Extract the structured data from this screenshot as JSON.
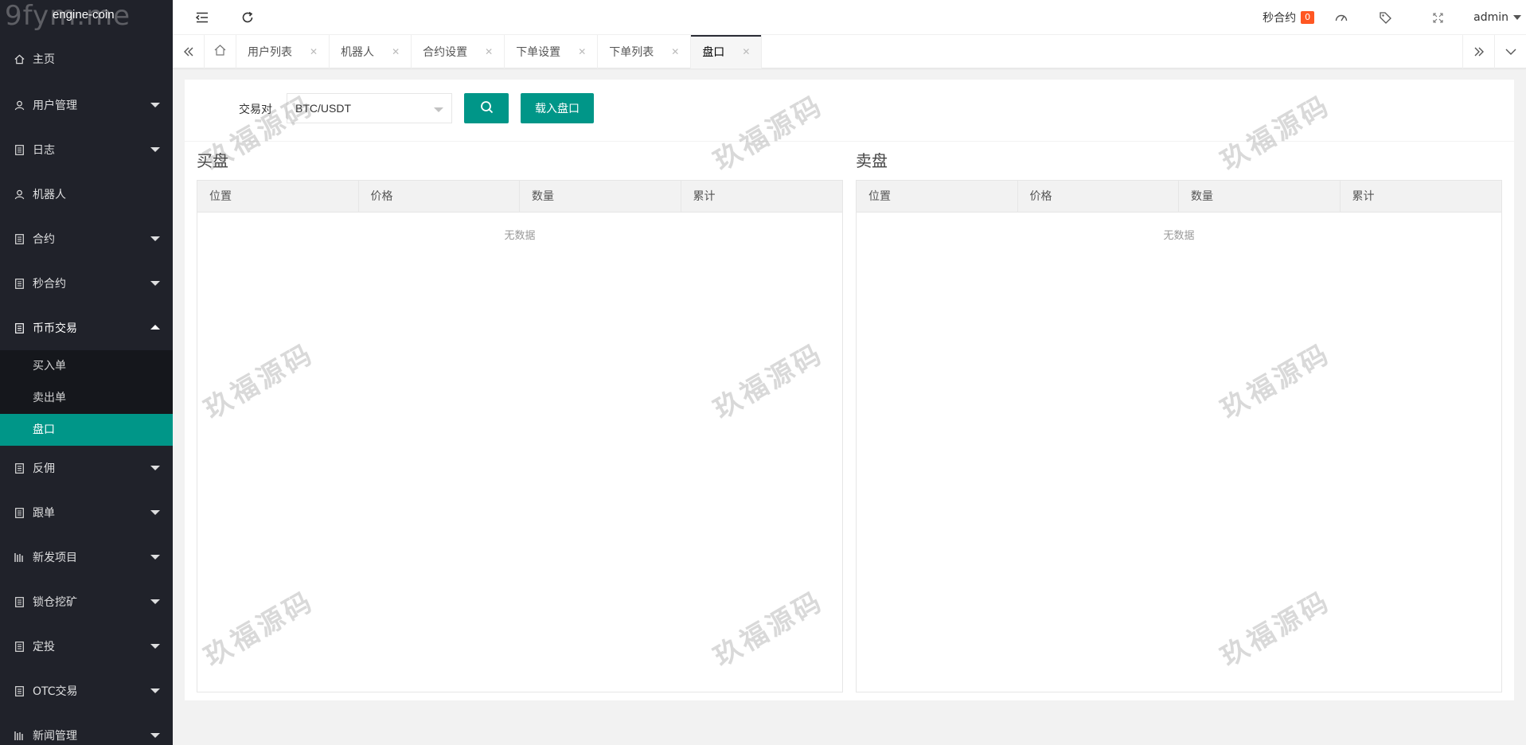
{
  "logo": {
    "watermark": "9fym.me",
    "title": "engine-coin"
  },
  "sidebar": {
    "items": [
      {
        "label": "主页",
        "icon": "home-icon",
        "expandable": false
      },
      {
        "label": "用户管理",
        "icon": "user-icon",
        "expandable": true
      },
      {
        "label": "日志",
        "icon": "document-icon",
        "expandable": true
      },
      {
        "label": "机器人",
        "icon": "user-icon",
        "expandable": false
      },
      {
        "label": "合约",
        "icon": "document-icon",
        "expandable": true
      },
      {
        "label": "秒合约",
        "icon": "document-icon",
        "expandable": true
      },
      {
        "label": "币币交易",
        "icon": "document-icon",
        "expandable": true,
        "open": true,
        "children": [
          {
            "label": "买入单"
          },
          {
            "label": "卖出单"
          },
          {
            "label": "盘口",
            "active": true
          }
        ]
      },
      {
        "label": "反佣",
        "icon": "document-icon",
        "expandable": true
      },
      {
        "label": "跟单",
        "icon": "document-icon",
        "expandable": true
      },
      {
        "label": "新发项目",
        "icon": "list-icon",
        "expandable": true
      },
      {
        "label": "锁仓挖矿",
        "icon": "document-icon",
        "expandable": true
      },
      {
        "label": "定投",
        "icon": "document-icon",
        "expandable": true
      },
      {
        "label": "OTC交易",
        "icon": "document-icon",
        "expandable": true
      },
      {
        "label": "新闻管理",
        "icon": "list-icon",
        "expandable": true
      }
    ]
  },
  "header": {
    "second_contract_label": "秒合约",
    "second_contract_badge": "0",
    "user": "admin"
  },
  "tabs": {
    "items": [
      {
        "label": "用户列表"
      },
      {
        "label": "机器人"
      },
      {
        "label": "合约设置"
      },
      {
        "label": "下单设置"
      },
      {
        "label": "下单列表"
      },
      {
        "label": "盘口",
        "active": true
      }
    ],
    "close_glyph": "✕"
  },
  "toolbar": {
    "pair_label": "交易对",
    "pair_value": "BTC/USDT",
    "load_button": "载入盘口"
  },
  "buy_panel": {
    "title": "买盘",
    "columns": [
      "位置",
      "价格",
      "数量",
      "累计"
    ],
    "empty_text": "无数据"
  },
  "sell_panel": {
    "title": "卖盘",
    "columns": [
      "位置",
      "价格",
      "数量",
      "累计"
    ],
    "empty_text": "无数据"
  },
  "watermark_text": "玖福源码",
  "colors": {
    "accent": "#009688",
    "sidebar_bg": "#20222a",
    "badge": "#ff5722"
  }
}
